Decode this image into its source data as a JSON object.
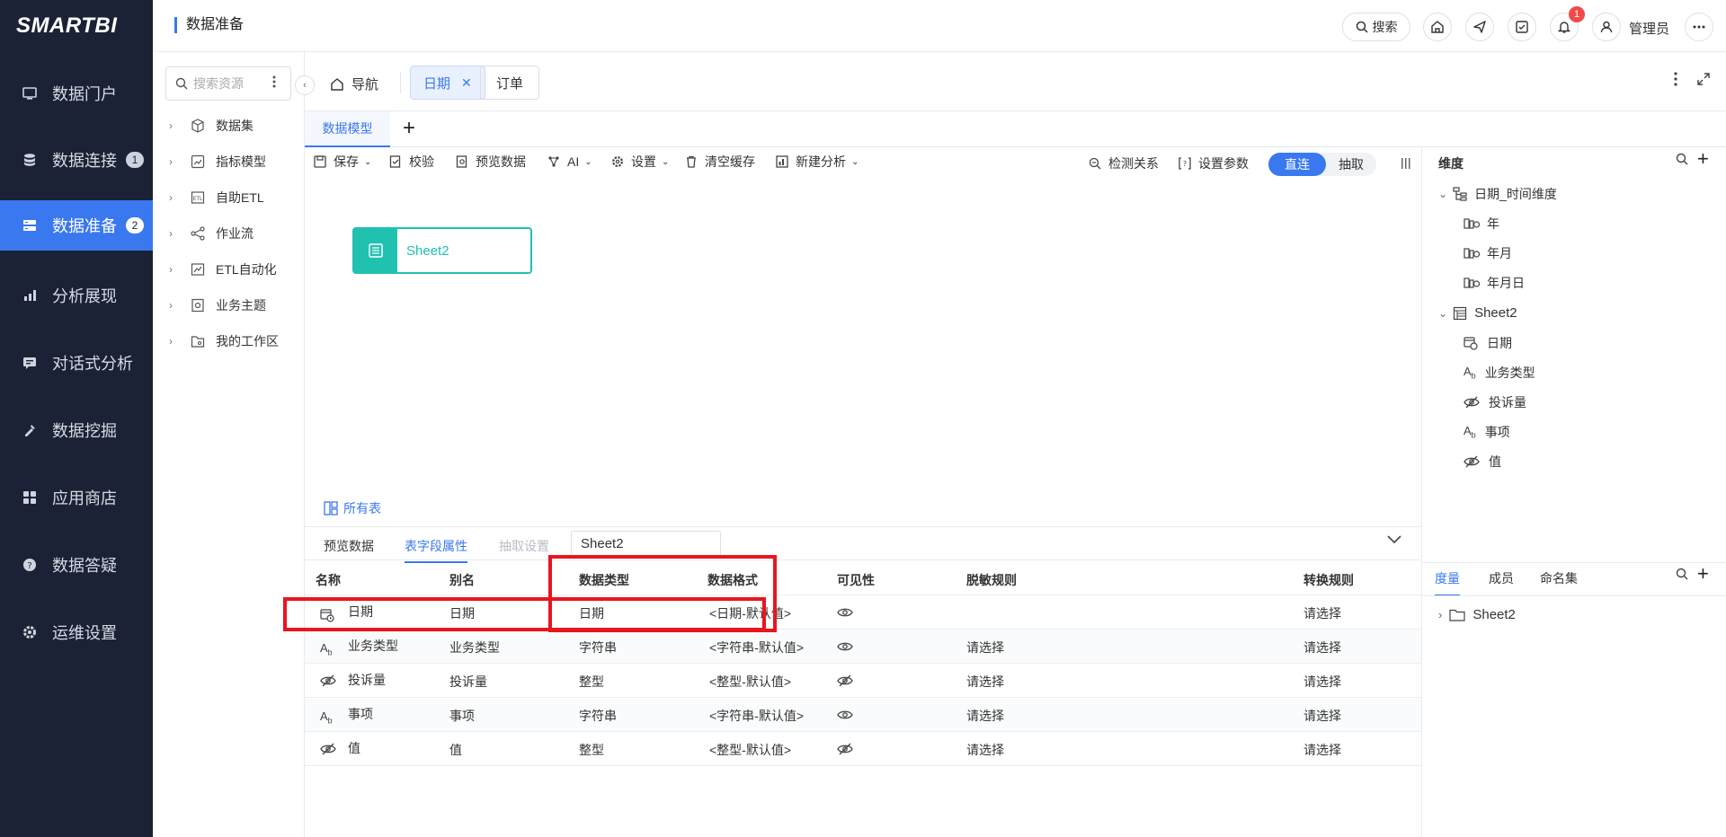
{
  "brand": {
    "logo": "SMARTBI"
  },
  "leftnav": {
    "items": [
      {
        "label": "数据门户",
        "badge": ""
      },
      {
        "label": "数据连接",
        "badge": "1"
      },
      {
        "label": "数据准备",
        "badge": "2"
      },
      {
        "label": "分析展现",
        "badge": ""
      },
      {
        "label": "对话式分析",
        "badge": ""
      },
      {
        "label": "数据挖掘",
        "badge": ""
      },
      {
        "label": "应用商店",
        "badge": ""
      },
      {
        "label": "数据答疑",
        "badge": ""
      },
      {
        "label": "运维设置",
        "badge": ""
      }
    ]
  },
  "header": {
    "title": "数据准备",
    "search_label": "搜索",
    "notification_count": "1",
    "user_label": "管理员"
  },
  "resources": {
    "search_placeholder": "搜索资源",
    "items": [
      "数据集",
      "指标模型",
      "自助ETL",
      "作业流",
      "ETL自动化",
      "业务主题",
      "我的工作区"
    ]
  },
  "tabs": {
    "nav_label": "导航",
    "date_label": "日期",
    "order_label": "订单"
  },
  "subtabs": {
    "model_label": "数据模型",
    "add_label": "+"
  },
  "toolbar": {
    "save": "保存",
    "validate": "校验",
    "preview": "预览数据",
    "ai": "AI",
    "settings": "设置",
    "clear_cache": "清空缓存",
    "new_analysis": "新建分析",
    "detect_relation": "检测关系",
    "set_params": "设置参数",
    "direct": "直连",
    "extract": "抽取"
  },
  "canvas": {
    "node_label": "Sheet2",
    "all_tables": "所有表"
  },
  "bottom": {
    "tabs": [
      "预览数据",
      "表字段属性",
      "抽取设置"
    ],
    "table_select": "Sheet2",
    "headers": [
      "名称",
      "别名",
      "数据类型",
      "数据格式",
      "可见性",
      "脱敏规则",
      "转换规则"
    ],
    "rows": [
      {
        "name": "日期",
        "alias": "日期",
        "type": "日期",
        "format": "<日期-默认值>",
        "mask": "",
        "convert": "请选择"
      },
      {
        "name": "业务类型",
        "alias": "业务类型",
        "type": "字符串",
        "format": "<字符串-默认值>",
        "mask": "请选择",
        "convert": "请选择"
      },
      {
        "name": "投诉量",
        "alias": "投诉量",
        "type": "整型",
        "format": "<整型-默认值>",
        "mask": "请选择",
        "convert": "请选择"
      },
      {
        "name": "事项",
        "alias": "事项",
        "type": "字符串",
        "format": "<字符串-默认值>",
        "mask": "请选择",
        "convert": "请选择"
      },
      {
        "name": "值",
        "alias": "值",
        "type": "整型",
        "format": "<整型-默认值>",
        "mask": "请选择",
        "convert": "请选择"
      }
    ]
  },
  "dimensions": {
    "title": "维度",
    "time_dim": "日期_时间维度",
    "time_levels": [
      "年",
      "年月",
      "年月日"
    ],
    "sheet": "Sheet2",
    "fields": [
      "日期",
      "业务类型",
      "投诉量",
      "事项",
      "值"
    ]
  },
  "measures": {
    "tabs": [
      "度量",
      "成员",
      "命名集"
    ],
    "folder": "Sheet2"
  }
}
